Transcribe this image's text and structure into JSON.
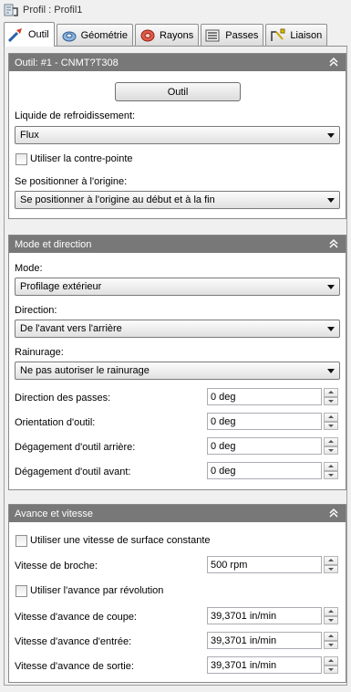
{
  "window": {
    "title": "Profil : Profil1",
    "icon": "profile-icon"
  },
  "tabs": [
    {
      "label": "Outil",
      "icon": "tool-tab-icon",
      "active": true
    },
    {
      "label": "Géométrie",
      "icon": "geometry-tab-icon",
      "active": false
    },
    {
      "label": "Rayons",
      "icon": "radii-tab-icon",
      "active": false
    },
    {
      "label": "Passes",
      "icon": "passes-tab-icon",
      "active": false
    },
    {
      "label": "Liaison",
      "icon": "linking-tab-icon",
      "active": false
    }
  ],
  "outil": {
    "header": "Outil: #1 - CNMT?T308",
    "tool_button": "Outil",
    "coolant_label": "Liquide de refroidissement:",
    "coolant_value": "Flux",
    "tailstock_label": "Utiliser la contre-pointe",
    "tailstock_checked": false,
    "home_label": "Se positionner à l'origine:",
    "home_value": "Se positionner à l'origine au début et à la fin"
  },
  "mode": {
    "header": "Mode et direction",
    "mode_label": "Mode:",
    "mode_value": "Profilage extérieur",
    "direction_label": "Direction:",
    "direction_value": "De l'avant vers l'arrière",
    "grooving_label": "Rainurage:",
    "grooving_value": "Ne pas autoriser le rainurage",
    "pass_direction_label": "Direction des passes:",
    "pass_direction_value": "0 deg",
    "tool_orientation_label": "Orientation d'outil:",
    "tool_orientation_value": "0 deg",
    "back_clearance_label": "Dégagement d'outil arrière:",
    "back_clearance_value": "0 deg",
    "front_clearance_label": "Dégagement d'outil avant:",
    "front_clearance_value": "0 deg"
  },
  "feed": {
    "header": "Avance et vitesse",
    "css_label": "Utiliser une vitesse de surface constante",
    "css_checked": false,
    "spindle_label": "Vitesse de broche:",
    "spindle_value": "500 rpm",
    "per_rev_label": "Utiliser l'avance par révolution",
    "per_rev_checked": false,
    "cut_feed_label": "Vitesse d'avance de coupe:",
    "cut_feed_value": "39,3701 in/min",
    "lead_in_label": "Vitesse d'avance d'entrée:",
    "lead_in_value": "39,3701 in/min",
    "lead_out_label": "Vitesse d'avance de sortie:",
    "lead_out_value": "39,3701 in/min"
  }
}
